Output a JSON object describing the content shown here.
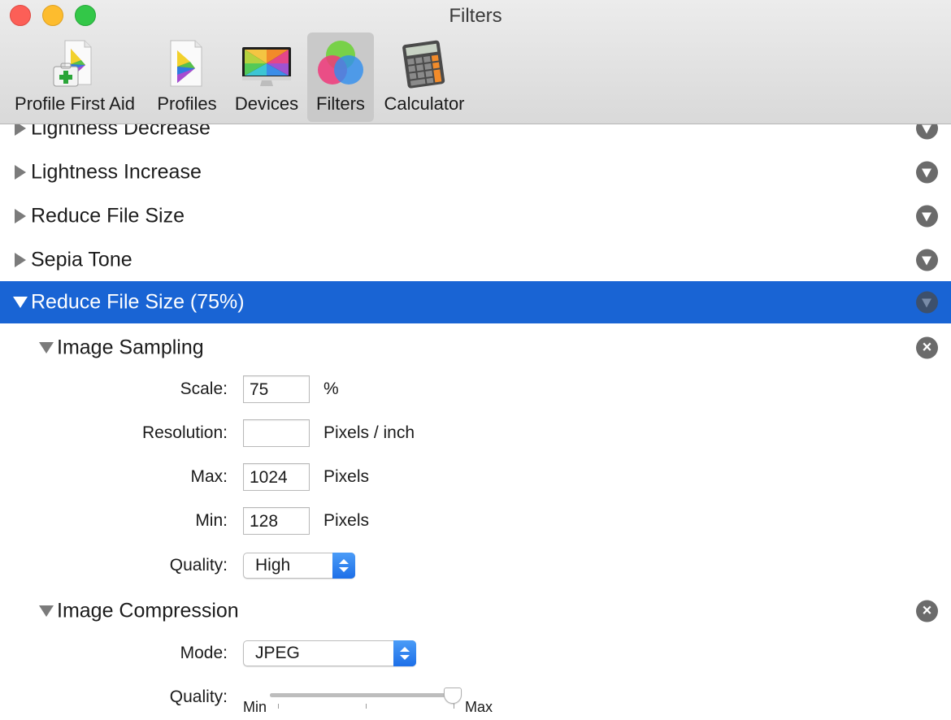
{
  "window": {
    "title": "Filters"
  },
  "toolbar": {
    "tabs": [
      {
        "label": "Profile First Aid",
        "icon": "profile-first-aid-icon"
      },
      {
        "label": "Profiles",
        "icon": "profiles-icon"
      },
      {
        "label": "Devices",
        "icon": "devices-monitor-icon"
      },
      {
        "label": "Filters",
        "icon": "filters-icon",
        "selected": true
      },
      {
        "label": "Calculator",
        "icon": "calculator-icon"
      }
    ]
  },
  "filters": [
    {
      "label": "Lightness Decrease"
    },
    {
      "label": "Lightness Increase"
    },
    {
      "label": "Reduce File Size"
    },
    {
      "label": "Sepia Tone"
    },
    {
      "label": "Reduce File Size (75%)",
      "selected": true,
      "expanded": true
    }
  ],
  "image_sampling": {
    "title": "Image Sampling",
    "scale": {
      "label": "Scale:",
      "value": "75",
      "unit": "%"
    },
    "resolution": {
      "label": "Resolution:",
      "value": "",
      "unit": "Pixels / inch"
    },
    "max": {
      "label": "Max:",
      "value": "1024",
      "unit": "Pixels"
    },
    "min": {
      "label": "Min:",
      "value": "128",
      "unit": "Pixels"
    },
    "quality": {
      "label": "Quality:",
      "value": "High"
    }
  },
  "image_compression": {
    "title": "Image Compression",
    "mode": {
      "label": "Mode:",
      "value": "JPEG"
    },
    "quality": {
      "label": "Quality:",
      "min_label": "Min",
      "max_label": "Max",
      "level": 0.97
    }
  },
  "colors": {
    "selection": "#1964d4",
    "accent": "#1d6fe8"
  }
}
